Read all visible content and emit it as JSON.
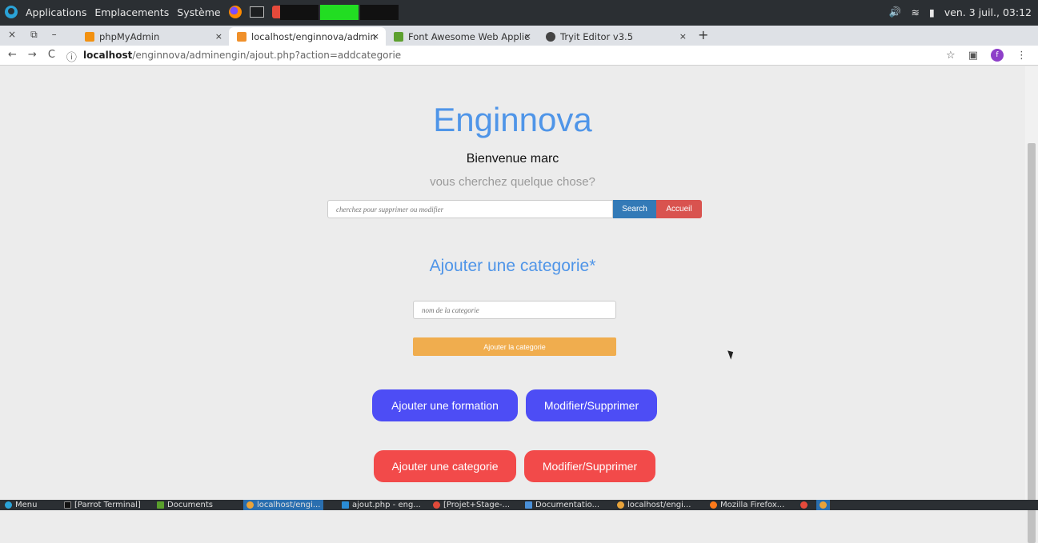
{
  "system_bar": {
    "menu_applications": "Applications",
    "menu_places": "Emplacements",
    "menu_system": "Système",
    "datetime": "ven. 3 juil., 03:12"
  },
  "tabs": [
    {
      "label": "phpMyAdmin",
      "close": "×",
      "favicon_color": "#f29111"
    },
    {
      "label": "localhost/enginnova/admin",
      "close": "×",
      "favicon_color": "#f0902a"
    },
    {
      "label": "Font Awesome Web Applic",
      "close": "×",
      "favicon_color": "#5da02f"
    },
    {
      "label": "Tryit Editor v3.5",
      "close": "×",
      "favicon_color": "#444444"
    }
  ],
  "tab_controls": {
    "close": "×",
    "new_tab": "+"
  },
  "address_bar": {
    "host": "localhost",
    "path": "/enginnova/adminengin/ajout.php?action=addcategorie",
    "profile_initial": "f"
  },
  "page": {
    "brand": "Enginnova",
    "welcome": "Bienvenue marc",
    "question": "vous cherchez quelque chose?",
    "search_placeholder": "cherchez pour supprimer ou modifier",
    "search_button": "Search",
    "home_button": "Accueil",
    "section_title": "Ajouter une categorie*",
    "category_placeholder": "nom de la categorie",
    "add_category_submit": "Ajouter la categorie",
    "btn_add_formation": "Ajouter une formation",
    "btn_modify_formation": "Modifier/Supprimer",
    "btn_add_category": "Ajouter une categorie",
    "btn_modify_category": "Modifier/Supprimer"
  },
  "taskbar": {
    "items": [
      {
        "label": "Menu"
      },
      {
        "label": "[Parrot Terminal]"
      },
      {
        "label": "Documents"
      },
      {
        "label": "localhost/engi..."
      },
      {
        "label": "ajout.php - eng..."
      },
      {
        "label": "[Projet+Stage-..."
      },
      {
        "label": "Documentatio..."
      },
      {
        "label": "localhost/engi..."
      },
      {
        "label": "Mozilla Firefox..."
      }
    ]
  },
  "colors": {
    "brand_blue": "#4f95e8",
    "search_blue": "#337ab7",
    "accueil_red": "#d9534f",
    "submit_orange": "#f0ad4e",
    "pill_blue": "#4d4df5",
    "pill_red": "#f24a4a"
  }
}
